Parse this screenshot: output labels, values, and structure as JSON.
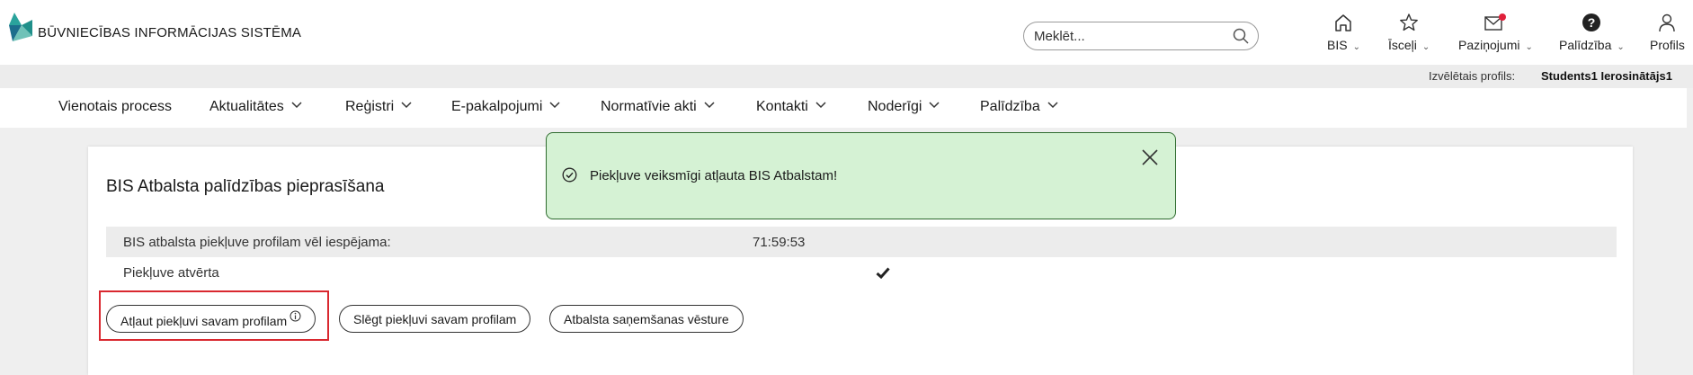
{
  "header": {
    "logo_text": "BŪVNIECĪBAS INFORMĀCIJAS SISTĒMA",
    "search": {
      "placeholder": "Meklēt..."
    },
    "nav": [
      {
        "label": "BIS",
        "icon": "home-icon"
      },
      {
        "label": "Īsceļi",
        "icon": "star-icon"
      },
      {
        "label": "Paziņojumi",
        "icon": "mail-icon"
      },
      {
        "label": "Palīdzība",
        "icon": "help-icon"
      },
      {
        "label": "Profils",
        "icon": "user-icon"
      }
    ]
  },
  "profile": {
    "label": "Izvēlētais profils:",
    "value": "Students1 Ierosinātājs1"
  },
  "menu": [
    {
      "label": "Vienotais process"
    },
    {
      "label": "Aktualitātes"
    },
    {
      "label": "Reģistri"
    },
    {
      "label": "E-pakalpojumi"
    },
    {
      "label": "Normatīvie akti"
    },
    {
      "label": "Kontakti"
    },
    {
      "label": "Noderīgi"
    },
    {
      "label": "Palīdzība"
    }
  ],
  "card": {
    "title": "BIS Atbalsta palīdzības pieprasīšana",
    "rows": [
      {
        "label": "BIS atbalsta piekļuve profilam vēl iespējama:",
        "value": "71:59:53"
      },
      {
        "label": "Piekļuve atvērta",
        "value_icon": "check-icon"
      }
    ],
    "buttons": [
      {
        "label": "Atļaut piekļuvi savam profilam"
      },
      {
        "label": "Slēgt piekļuvi savam profilam"
      },
      {
        "label": "Atbalsta saņemšanas vēsture"
      }
    ]
  },
  "toast": {
    "message": "Piekļuve veiksmīgi atļauta BIS Atbalstam!",
    "icon": "check-circle-icon"
  },
  "colors": {
    "toast_bg": "#d5f2d4",
    "toast_border": "#2e6b2e",
    "highlight": "#d9282f",
    "logo_teal": "#1f8f8a",
    "notification_dot": "#e0203a"
  }
}
